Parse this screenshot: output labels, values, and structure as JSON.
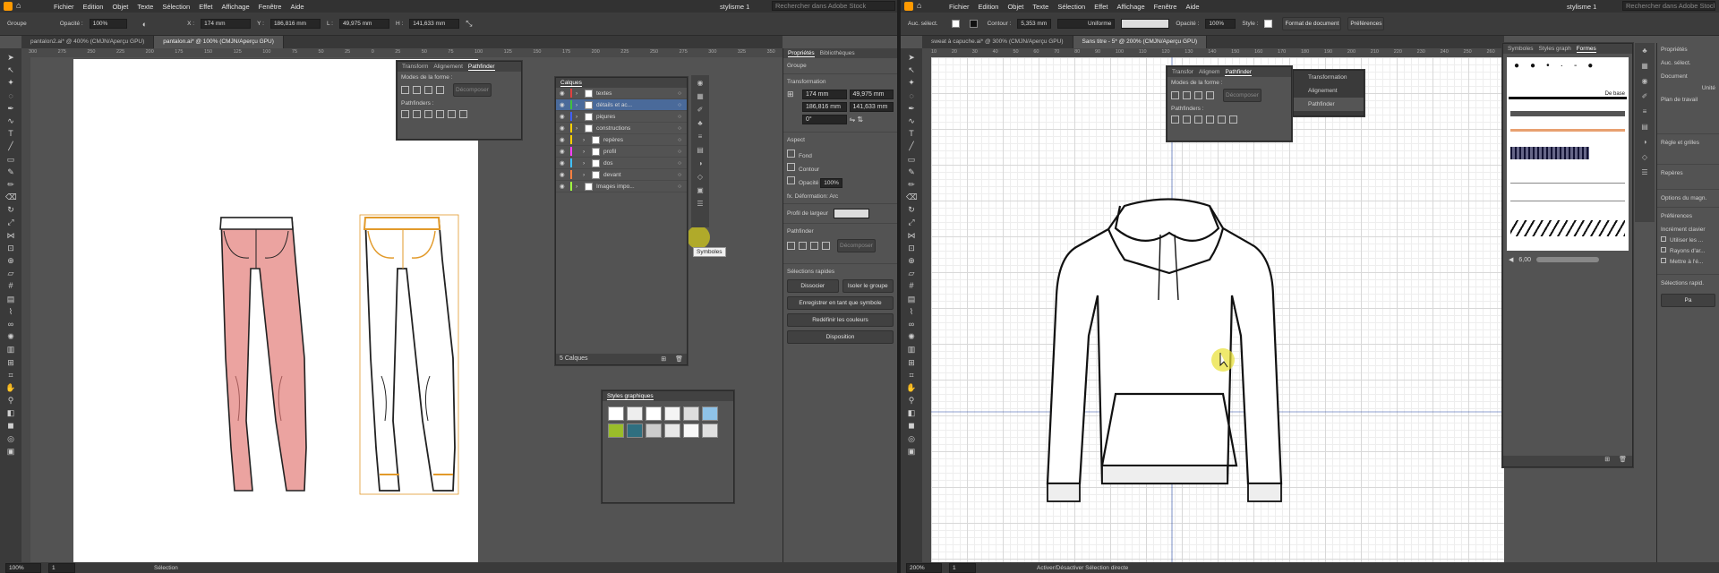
{
  "left": {
    "menu": [
      "Fichier",
      "Edition",
      "Objet",
      "Texte",
      "Sélection",
      "Effet",
      "Affichage",
      "Fenêtre",
      "Aide"
    ],
    "workspace": "stylisme 1",
    "search_placeholder": "Rechercher dans Adobe Stock",
    "control": {
      "group": "Groupe",
      "opacity_label": "Opacité :",
      "opacity": "100%",
      "x_label": "X :",
      "x": "174 mm",
      "y_label": "Y :",
      "y": "186,816 mm",
      "w_label": "L :",
      "w": "49,975 mm",
      "h_label": "H :",
      "h": "141,633 mm"
    },
    "tabs": [
      "pantalon2.ai* @ 400% (CMJN/Aperçu GPU)",
      "pantalon.ai* @ 100% (CMJN/Aperçu GPU)"
    ],
    "ruler_marks": [
      "300",
      "275",
      "250",
      "225",
      "200",
      "175",
      "150",
      "125",
      "100",
      "75",
      "50",
      "25",
      "0",
      "25",
      "50",
      "75",
      "100",
      "125",
      "150",
      "175",
      "200",
      "225",
      "250",
      "275",
      "300",
      "325",
      "350"
    ],
    "pathfinder": {
      "tabs": [
        "Transform",
        "Alignement",
        "Pathfinder"
      ],
      "modes": "Modes de la forme :",
      "expand": "Décomposer",
      "pathfinders": "Pathfinders :"
    },
    "layers": {
      "title": "Calques",
      "items": [
        {
          "name": "textes",
          "color": "#e04040",
          "indent": 0
        },
        {
          "name": "détails et ac...",
          "color": "#40c040",
          "indent": 0,
          "selected": true
        },
        {
          "name": "piqures",
          "color": "#4060ff",
          "indent": 0
        },
        {
          "name": "constructions",
          "color": "#ffd000",
          "indent": 0
        },
        {
          "name": "repères",
          "color": "#ffd000",
          "indent": 1
        },
        {
          "name": "profil",
          "color": "#ff40ff",
          "indent": 1
        },
        {
          "name": "dos",
          "color": "#40c0ff",
          "indent": 1
        },
        {
          "name": "devant",
          "color": "#ff8040",
          "indent": 1
        },
        {
          "name": "Images impo...",
          "color": "#a0ff40",
          "indent": 0
        }
      ],
      "count": "5 Calques"
    },
    "tooltip": "Symboles",
    "graphic_styles": "Styles graphiques",
    "properties": {
      "tabs": [
        "Propriétés",
        "Bibliothèques"
      ],
      "group": "Groupe",
      "transform": "Transformation",
      "x": "174 mm",
      "y": "186,816 mm",
      "w": "49,975 mm",
      "h": "141,633 mm",
      "angle": "0°",
      "appearance": "Aspect",
      "fill": "Fond",
      "stroke": "Contour",
      "opacity_label": "Opacité",
      "opacity": "100%",
      "effect": "Déformation: Arc",
      "width_profile": "Profil de largeur",
      "pathfinder": "Pathfinder",
      "expand": "Décomposer",
      "quick": "Sélections rapides",
      "ungroup": "Dissocier",
      "isolate": "Isoler le groupe",
      "save_symbol": "Enregistrer en tant que symbole",
      "recolor": "Redéfinir les couleurs",
      "arrange": "Disposition"
    },
    "status": {
      "zoom": "100%",
      "page": "1",
      "tool": "Sélection"
    }
  },
  "right": {
    "menu": [
      "Fichier",
      "Edition",
      "Objet",
      "Texte",
      "Sélection",
      "Effet",
      "Affichage",
      "Fenêtre",
      "Aide"
    ],
    "workspace": "stylisme 1",
    "search_placeholder": "Rechercher dans Adobe Stock",
    "control": {
      "sel": "Auc. sélect.",
      "stroke_label": "Contour :",
      "stroke": "5,353 mm",
      "uniform": "Uniforme",
      "opacity_label": "Opacité :",
      "opacity": "100%",
      "style_label": "Style :",
      "doc": "Format de document",
      "prefs": "Préférences"
    },
    "tabs": [
      "sweat à capuche.ai* @ 300% (CMJN/Aperçu GPU)",
      "Sans titre - 5* @ 200% (CMJN/Aperçu GPU)"
    ],
    "ruler_marks": [
      "10",
      "20",
      "30",
      "40",
      "50",
      "60",
      "70",
      "80",
      "90",
      "100",
      "110",
      "120",
      "130",
      "140",
      "150",
      "160",
      "170",
      "180",
      "190",
      "200",
      "210",
      "220",
      "230",
      "240",
      "250",
      "260"
    ],
    "pathfinder": {
      "tabs": [
        "Transfor",
        "Alignem",
        "Pathfinder"
      ],
      "modes": "Modes de la forme :",
      "expand": "Décomposer",
      "pathfinders": "Pathfinders :"
    },
    "flyout": [
      "Transformation",
      "Alignement",
      "Pathfinder"
    ],
    "brushes": {
      "tabs": [
        "Symboles",
        "Styles graph",
        "Formes"
      ],
      "basic": "De base",
      "size": "6,00"
    },
    "properties": {
      "title": "Propriétés",
      "none": "Auc. sélect.",
      "doc": "Document",
      "unit": "Unité",
      "plan": "Plan de travail",
      "rules": "Règle et grilles",
      "guides": "Repères",
      "align": "Options du magn.",
      "prefs": "Préférences",
      "incr": "Incrément clavier",
      "opt1": "Utiliser les ...",
      "opt2": "Rayons d'ar...",
      "opt3": "Mettre à l'é...",
      "quick": "Sélections rapid.",
      "btn": "Pa"
    },
    "status": {
      "zoom": "200%",
      "page": "1",
      "tool": "Activer/Désactiver Sélection directe"
    }
  }
}
